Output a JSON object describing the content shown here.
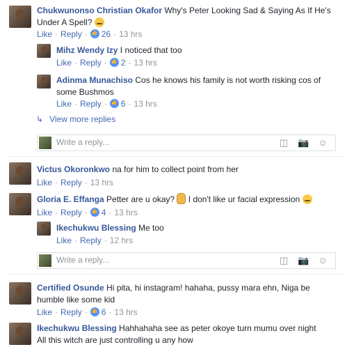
{
  "labels": {
    "like": "Like",
    "reply": "Reply",
    "dot": "·"
  },
  "comments": [
    {
      "name": "Chukwunonso Christian Okafor",
      "text_l1": "Why's Peter Looking Sad & Saying As If He's",
      "text_l2": "Under A Spell?",
      "emoji": "confused-face",
      "likes": "26",
      "time": "13 hrs",
      "replies": [
        {
          "name": "Mihz Wendy Izy",
          "text": "I noticed that too",
          "likes": "2",
          "time": "13 hrs"
        },
        {
          "name": "Adinma Munachiso",
          "text_l1": "Cos he knows his family is not worth risking cos of",
          "text_l2": "some Bushmos",
          "likes": "6",
          "time": "13 hrs"
        }
      ],
      "view_more": "View more replies"
    },
    {
      "name": "Victus Okoronkwo",
      "text": "na for him to collect point from her",
      "time": "13 hrs"
    },
    {
      "name": "Gloria E. Effanga",
      "text_a": "Petter are u okay?",
      "text_b": "I don't like ur facial expression",
      "emoji_ok": "ok-hand",
      "emoji_laugh": "laughing-face",
      "likes": "4",
      "time": "13 hrs",
      "replies": [
        {
          "name": "Ikechukwu Blessing",
          "text": "Me too",
          "time": "12 hrs"
        }
      ]
    },
    {
      "name": "Certified Osunde",
      "text_l1": "Hi pita, hi instagram! hahaha, pussy mara ehn, Niga be",
      "text_l2": "humble like some kid",
      "likes": "6",
      "time": "13 hrs"
    },
    {
      "name": "Ikechukwu Blessing",
      "text_l1": "Hahhahaha see as peter okoye turn mumu over night",
      "text_l2": "All this witch are just controlling u any how"
    }
  ],
  "reply_placeholder": "Write a reply...",
  "icons": [
    "like-icon",
    "camera-icon",
    "sticker-icon",
    "emoji-icon"
  ],
  "colors": {
    "name": "#365899",
    "link": "#4267b2",
    "meta": "#90949c",
    "like_badge": "#5890ff"
  }
}
